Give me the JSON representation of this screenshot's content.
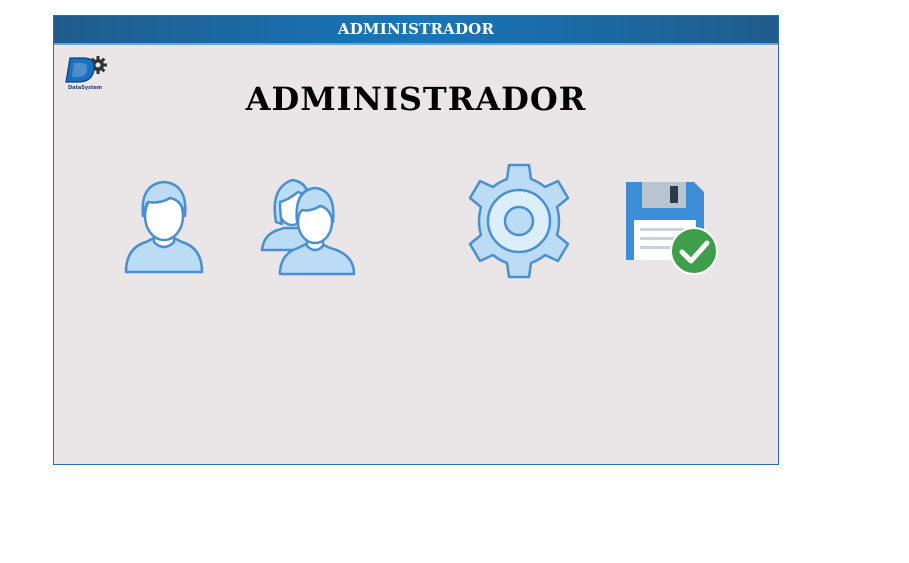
{
  "window": {
    "title": "ADMINISTRADOR"
  },
  "logo": {
    "icon": "datasystem-logo",
    "text": "DataSystem"
  },
  "page": {
    "heading": "ADMINISTRADOR"
  },
  "icons": [
    {
      "name": "user-icon"
    },
    {
      "name": "users-group-icon"
    },
    {
      "name": "gear-icon"
    },
    {
      "name": "save-icon"
    }
  ],
  "colors": {
    "titlebar": "#1976b8",
    "panel_bg": "#eae6e7",
    "icon_fill": "#bcdcf6",
    "icon_stroke": "#4a8fd1",
    "save_blue": "#3d8ed6",
    "check_green": "#3e9e4a"
  }
}
